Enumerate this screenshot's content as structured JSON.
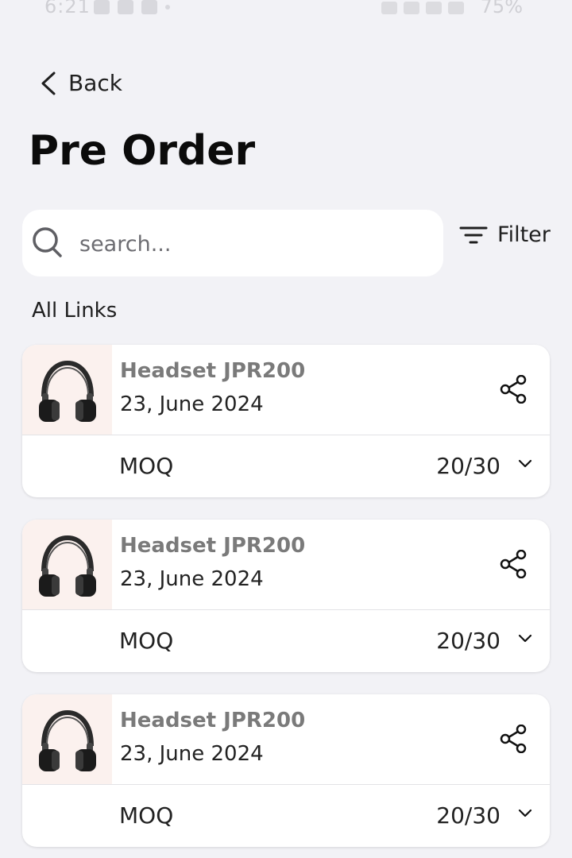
{
  "status_bar": {
    "time": "6:21",
    "battery": "75%"
  },
  "nav": {
    "back_label": "Back"
  },
  "page": {
    "title": "Pre Order"
  },
  "search": {
    "placeholder": "search..."
  },
  "filter": {
    "label": "Filter"
  },
  "section": {
    "label": "All Links"
  },
  "items": [
    {
      "name": "Headset JPR200",
      "date": "23, June 2024",
      "moq_label": "MOQ",
      "moq_value": "20/30"
    },
    {
      "name": "Headset JPR200",
      "date": "23, June 2024",
      "moq_label": "MOQ",
      "moq_value": "20/30"
    },
    {
      "name": "Headset JPR200",
      "date": "23, June 2024",
      "moq_label": "MOQ",
      "moq_value": "20/30"
    }
  ]
}
